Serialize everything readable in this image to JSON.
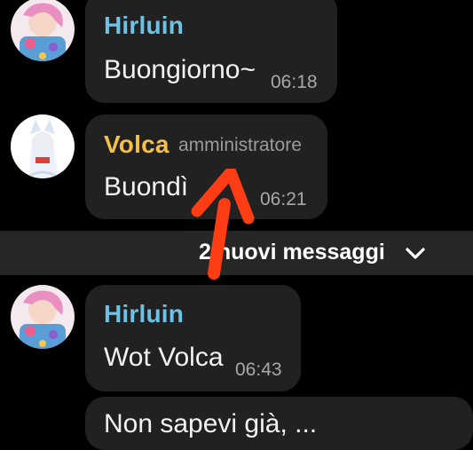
{
  "colors": {
    "background": "#000000",
    "bubble": "#212121",
    "hirluin_name": "#6ec1e4",
    "volca_name": "#f5c043",
    "annotation_arrow": "#ff3d14"
  },
  "messages": [
    {
      "author": "Hirluin",
      "text": "Buongiorno~",
      "time": "06:18",
      "avatar": "anime-avatar-pink"
    },
    {
      "author": "Volca",
      "role": "amministratore",
      "text": "Buondì",
      "time": "06:21",
      "avatar": "anime-avatar-white-fox"
    },
    {
      "author": "Hirluin",
      "text": "Wot Volca",
      "time": "06:43",
      "avatar": "anime-avatar-pink"
    },
    {
      "text": "Non sapevi già, ..."
    }
  ],
  "divider": {
    "label": "2 nuovi messaggi",
    "icon": "chevron-down-icon"
  },
  "annotation": {
    "icon": "red-arrow-up-icon"
  }
}
